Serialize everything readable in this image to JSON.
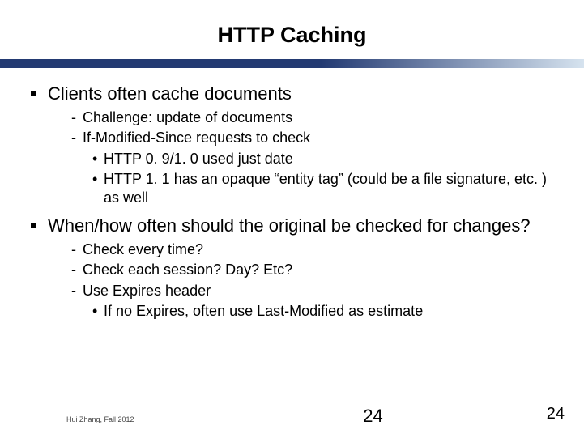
{
  "title": "HTTP Caching",
  "bullet1": {
    "text": "Clients often cache documents",
    "dash1": "Challenge: update of documents",
    "dash2": "If-Modified-Since requests to check",
    "dot1": "HTTP 0. 9/1. 0 used just date",
    "dot2": "HTTP 1. 1 has an opaque “entity tag” (could be a file signature, etc. ) as well"
  },
  "bullet2": {
    "text": "When/how often should the original be checked for changes?",
    "dash1": "Check every time?",
    "dash2": "Check each session? Day? Etc?",
    "dash3": "Use Expires header",
    "dot1": "If no Expires, often use Last-Modified as estimate"
  },
  "footer": "Hui Zhang, Fall 2012",
  "page_center": "24",
  "page_right": "24"
}
